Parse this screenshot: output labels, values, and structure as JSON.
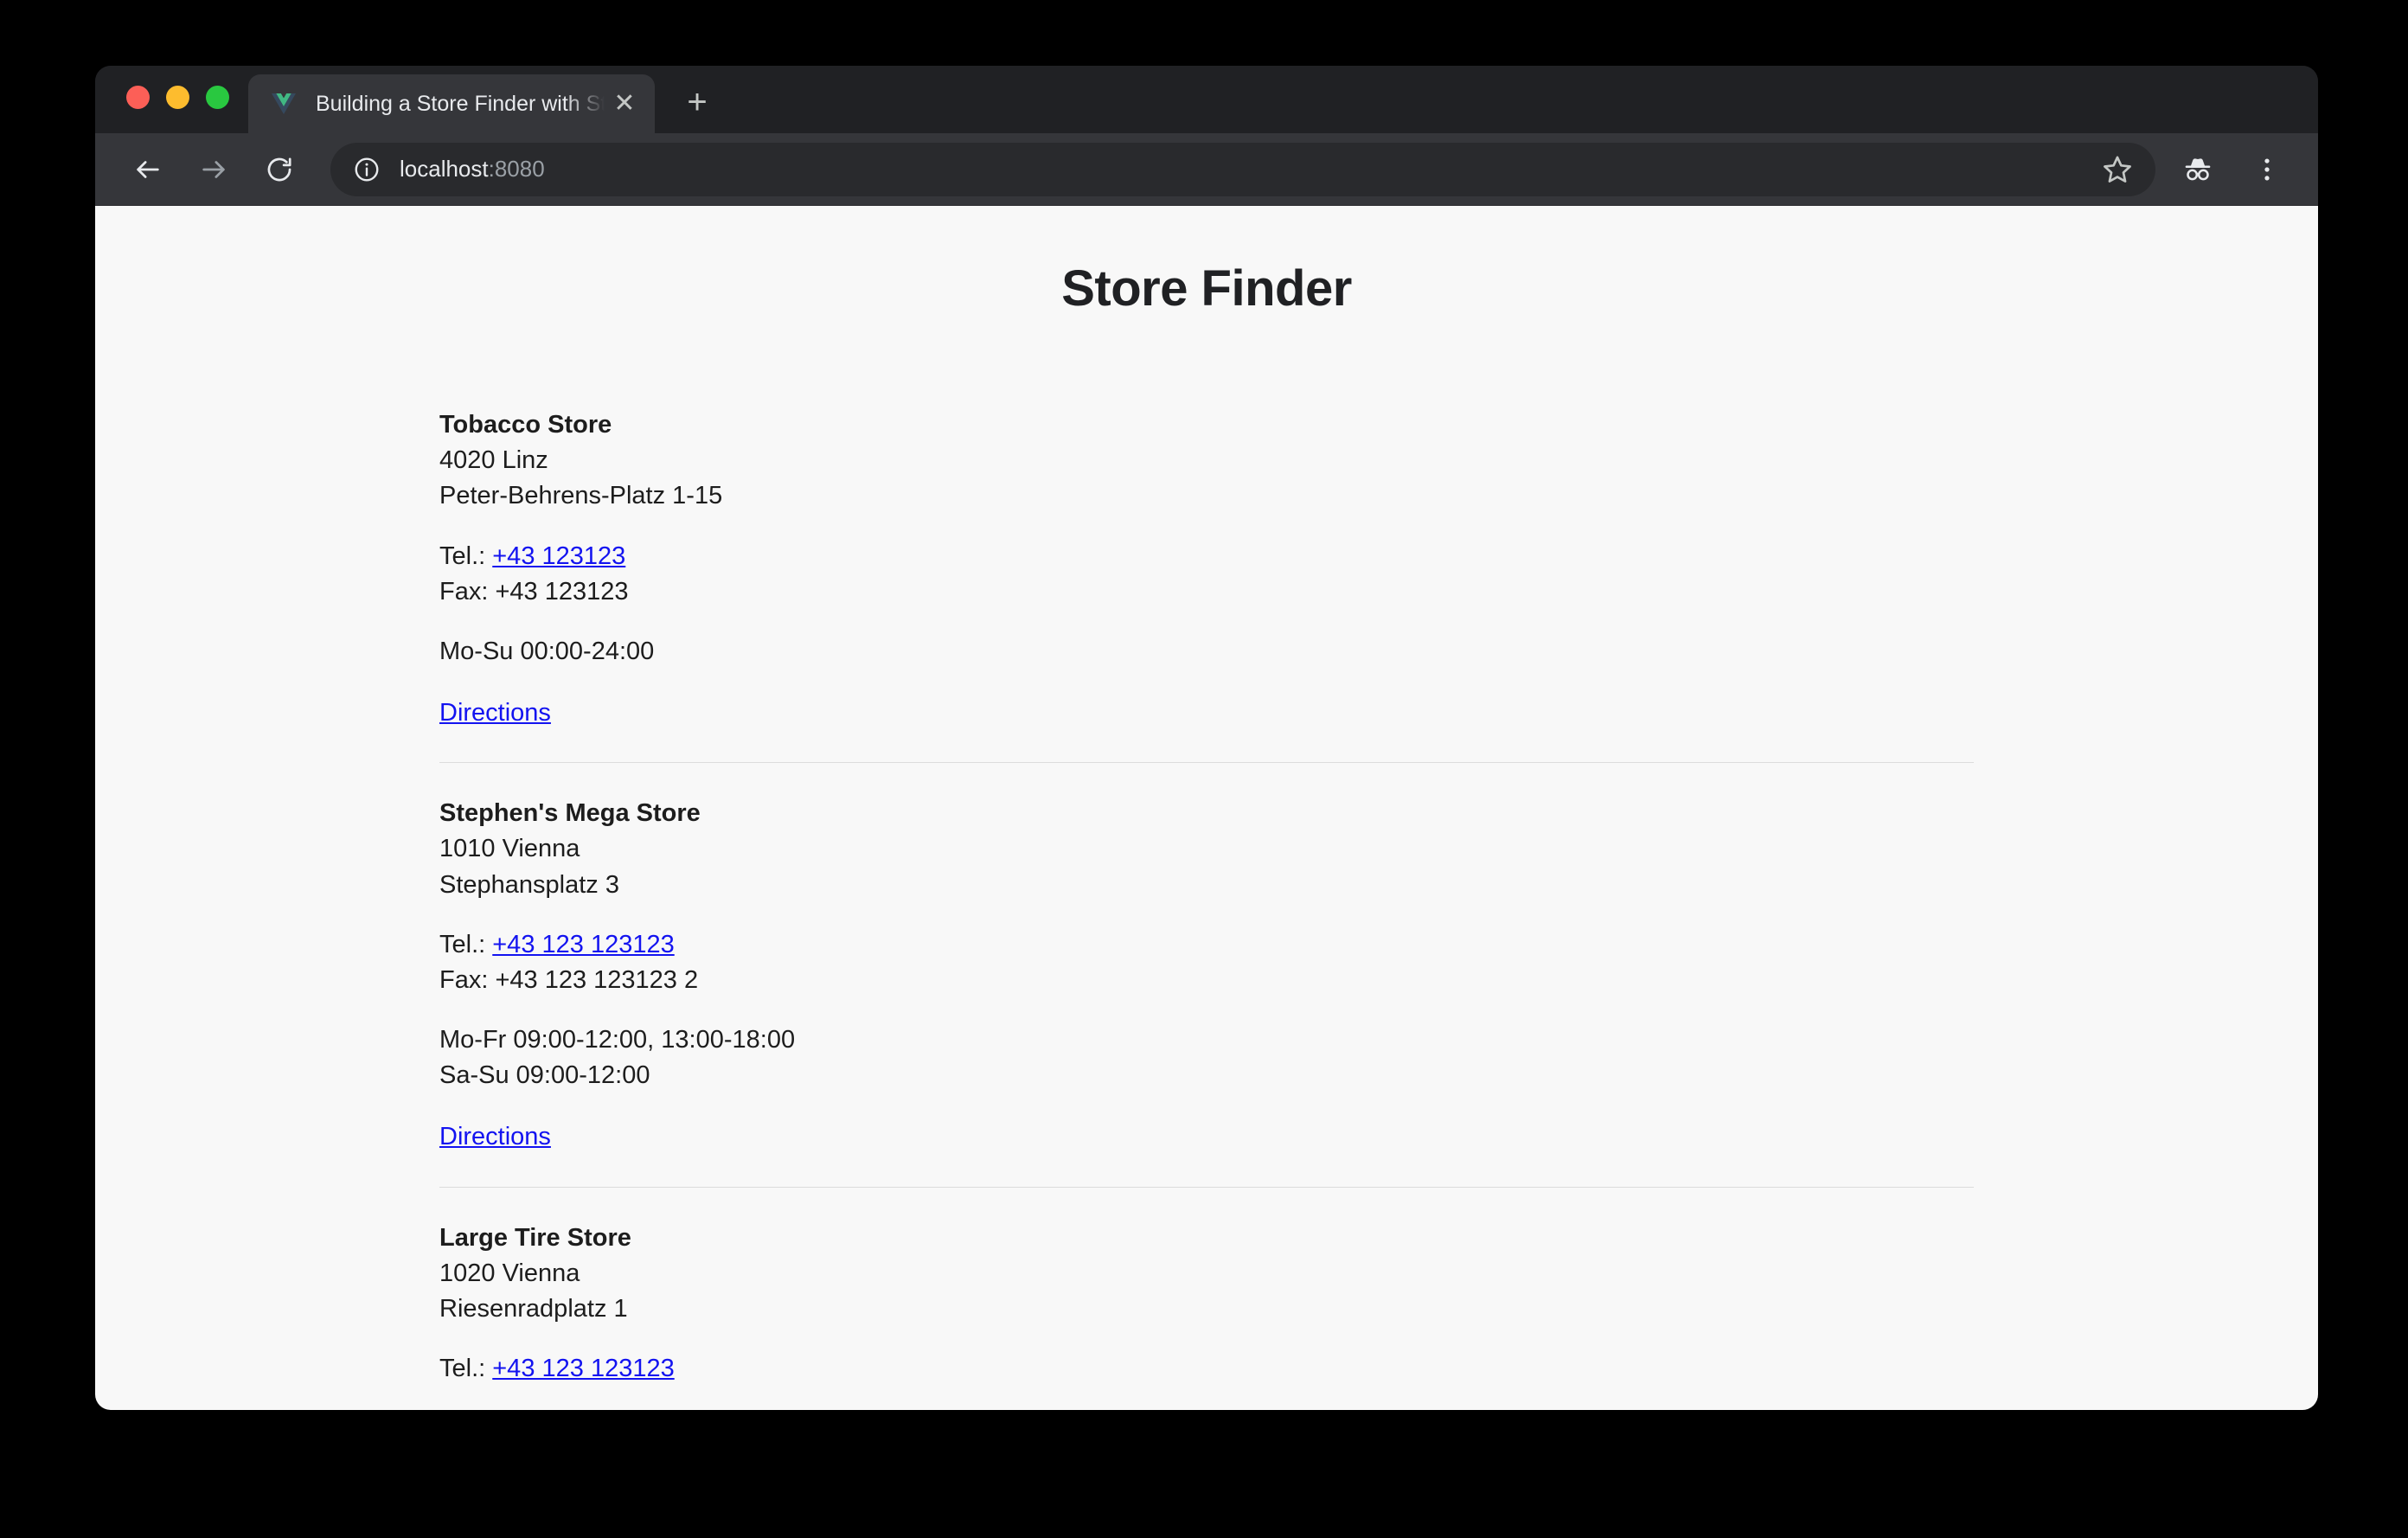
{
  "window": {
    "traffic_lights": [
      {
        "name": "close",
        "color": "#fc5f57"
      },
      {
        "name": "minimize",
        "color": "#fdbc2e"
      },
      {
        "name": "maximize",
        "color": "#29c840"
      }
    ]
  },
  "tabs": {
    "active": {
      "title": "Building a Store Finder with Sto",
      "favicon": "vue-logo-icon",
      "close_label": "✕"
    },
    "new_tab_label": "+"
  },
  "toolbar": {
    "back_label": "back-arrow-icon",
    "forward_label": "forward-arrow-icon",
    "reload_label": "reload-icon",
    "site_info_label": "info-circle-icon",
    "url_host": "localhost",
    "url_port": ":8080",
    "url_full": "localhost:8080",
    "bookmark_label": "star-icon",
    "incognito_label": "incognito-icon",
    "menu_label": "three-dot-menu-icon"
  },
  "page": {
    "heading": "Store Finder",
    "stores": [
      {
        "name": "Tobacco Store",
        "postal_city": "4020 Linz",
        "street": "Peter-Behrens-Platz 1-15",
        "tel_label": "Tel.: ",
        "tel_number": "+43 123123",
        "fax_line": "Fax: +43 123123",
        "hours": [
          "Mo-Su  00:00-24:00"
        ],
        "directions_label": "Directions"
      },
      {
        "name": "Stephen's Mega Store",
        "postal_city": "1010 Vienna",
        "street": "Stephansplatz 3",
        "tel_label": "Tel.: ",
        "tel_number": "+43 123 123123",
        "fax_line": "Fax: +43 123 123123 2",
        "hours": [
          "Mo-Fr  09:00-12:00, 13:00-18:00",
          "Sa-Su  09:00-12:00"
        ],
        "directions_label": "Directions"
      },
      {
        "name": "Large Tire Store",
        "postal_city": "1020 Vienna",
        "street": "Riesenradplatz 1",
        "tel_label": "Tel.: ",
        "tel_number": "+43 123 123123",
        "fax_line": "",
        "hours": [],
        "directions_label": ""
      }
    ]
  },
  "colors": {
    "link": "#1313f0",
    "page_background": "#f8f8f8",
    "tab_strip": "#202124",
    "toolbar": "#35363a",
    "omnibox": "#292a2d"
  }
}
